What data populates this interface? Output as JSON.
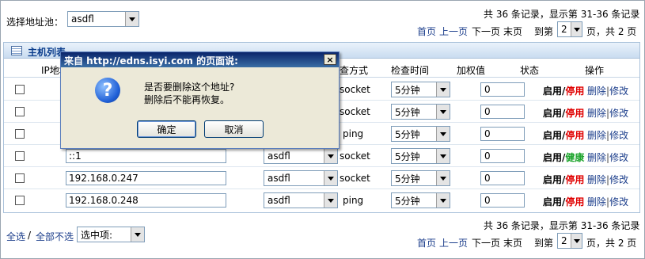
{
  "top": {
    "pool_label": "选择地址池：",
    "pool_value": "asdfl",
    "summary": "共 36 条记录，显示第 31-36 条记录"
  },
  "pager": {
    "first": "首页",
    "prev": "上一页",
    "next": "下一页",
    "last": "末页",
    "goto_prefix": "到第",
    "page_value": "2",
    "goto_suffix": "页，共 2 页"
  },
  "panel": {
    "title": "主机列表",
    "columns": {
      "ip": "IP地址",
      "method": "检查方式",
      "interval": "检查时间",
      "weight": "加权值",
      "status": "状态",
      "ops": "操作"
    }
  },
  "rows": [
    {
      "ip": "",
      "pool": "",
      "type": "socket",
      "interval": "5分钟",
      "weight": "0",
      "status_a": "启用",
      "status_b": "停用",
      "del": "删除",
      "edit": "修改"
    },
    {
      "ip": "",
      "pool": "",
      "type": "socket",
      "interval": "5分钟",
      "weight": "0",
      "status_a": "启用",
      "status_b": "停用",
      "del": "删除",
      "edit": "修改"
    },
    {
      "ip": "",
      "pool": "",
      "type": "ping",
      "interval": "5分钟",
      "weight": "0",
      "status_a": "启用",
      "status_b": "停用",
      "del": "删除",
      "edit": "修改"
    },
    {
      "ip": "::1",
      "pool": "asdfl",
      "type": "socket",
      "interval": "5分钟",
      "weight": "0",
      "status_a": "启用",
      "status_b": "健康",
      "del": "删除",
      "edit": "修改"
    },
    {
      "ip": "192.168.0.247",
      "pool": "asdfl",
      "type": "socket",
      "interval": "5分钟",
      "weight": "0",
      "status_a": "启用",
      "status_b": "停用",
      "del": "删除",
      "edit": "修改"
    },
    {
      "ip": "192.168.0.248",
      "pool": "asdfl",
      "type": "ping",
      "interval": "5分钟",
      "weight": "0",
      "status_a": "启用",
      "status_b": "停用",
      "del": "删除",
      "edit": "修改"
    }
  ],
  "bottom": {
    "select_all": "全选",
    "slash": "/",
    "deselect_all": "全部不选",
    "action_label": "选中项:",
    "summary": "共 36 条记录，显示第 31-36 条记录"
  },
  "dialog": {
    "title": "来自 http://edns.isyi.com 的页面说:",
    "close": "×",
    "icon": "?",
    "line1": "是否要删除这个地址?",
    "line2": "删除后不能再恢复。",
    "ok": "确定",
    "cancel": "取消"
  },
  "colors": {
    "link": "#1d3f8c",
    "disabled_red": "#e00000",
    "healthy_green": "#1aa32a",
    "titlebar": "#0a246a"
  }
}
